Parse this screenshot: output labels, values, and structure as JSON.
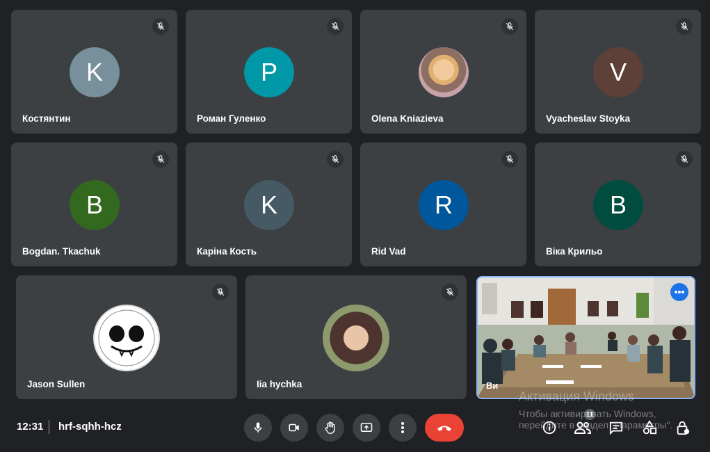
{
  "participants": [
    {
      "name": "Костянтин",
      "initial": "K",
      "color": "#78909c"
    },
    {
      "name": "Роман Гуленко",
      "initial": "P",
      "color": "#0097a7"
    },
    {
      "name": "Olena Kniazieva",
      "initial": "",
      "color": "#d7a86e"
    },
    {
      "name": "Vyacheslav Stoyka",
      "initial": "V",
      "color": "#5d4037"
    },
    {
      "name": "Bogdan. Tkachuk",
      "initial": "B",
      "color": "#33691e"
    },
    {
      "name": "Каріна Кость",
      "initial": "K",
      "color": "#455a64"
    },
    {
      "name": "Rid Vad",
      "initial": "R",
      "color": "#01579b"
    },
    {
      "name": "Віка Крильо",
      "initial": "B",
      "color": "#004d40"
    },
    {
      "name": "Jason Sullen",
      "initial": "",
      "color": "#ffffff"
    },
    {
      "name": "Iia hychka",
      "initial": "",
      "color": "#6d4c41"
    }
  ],
  "self_view": {
    "name": "Ви"
  },
  "bottombar": {
    "time": "12:31",
    "meeting_code": "hrf-sqhh-hcz",
    "people_count": "11"
  },
  "watermark": {
    "line1": "Активация Windows",
    "line2": "Чтобы активировать Windows, перейдите в раздел \"Параметры\"."
  },
  "colors": {
    "end_call": "#ea4335",
    "accent": "#1a73e8",
    "tile_bg": "#3c4043"
  }
}
